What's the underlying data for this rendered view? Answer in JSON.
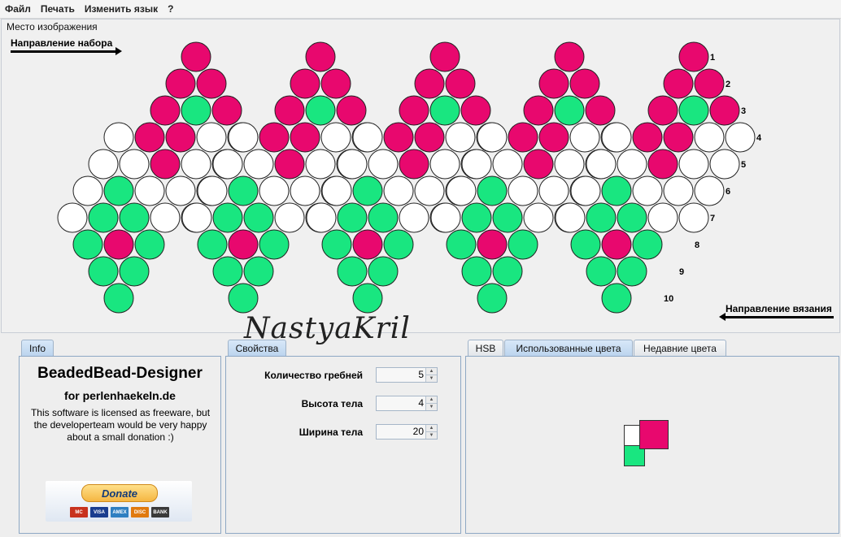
{
  "menu": [
    "Файл",
    "Печать",
    "Изменить язык",
    "?"
  ],
  "canvas": {
    "caption": "Место изображения",
    "direction_set": "Направление набора",
    "direction_knit": "Направление вязания",
    "row_labels": [
      "1",
      "2",
      "3",
      "4",
      "5",
      "6",
      "7",
      "8",
      "9",
      "10"
    ],
    "colors": {
      "pink": "#e8086e",
      "green": "#19e680",
      "white": "#ffffff"
    },
    "pattern": {
      "ribs": 5,
      "rows": [
        "WWWWWWWWWPWWWWWWWWWPWWWWWWWWWPWWWWWWWWWPWWWWWWWWWP",
        "WWWWWWWWPPWWWWWWWWPPWWWWWWWWPPWWWWWWWWPPWWWWWWWWPP",
        "WWWWWWWPGPWWWWWWWPGPWWWWWWWPGPWWWWWWWPGPWWWWWWWPGP",
        "WWWWWWPPWWWWWWWWPPWWWWWWWWPPWWWWWWWWPPWWWWWWWWPPWW"
      ]
    }
  },
  "signature": "NastyaKril",
  "info": {
    "tab": "Info",
    "title": "BeadedBead-Designer",
    "subtitle": "for perlenhaekeln.de",
    "text": "This software is licensed as freeware, but the developerteam would be very happy about a small donation :)",
    "donate_label": "Donate",
    "cards": [
      "MC",
      "VISA",
      "AMEX",
      "DISC",
      "BANK"
    ]
  },
  "properties": {
    "tab": "Свойства",
    "fields": [
      {
        "label": "Количество гребней",
        "value": "5"
      },
      {
        "label": "Высота тела",
        "value": "4"
      },
      {
        "label": "Ширина тела",
        "value": "20"
      }
    ]
  },
  "colors_panel": {
    "tabs": [
      "HSB",
      "Использованные цвета",
      "Недавние цвета"
    ],
    "selected_tab": 1,
    "used_colors": [
      "#e8086e",
      "#ffffff",
      "#19e680"
    ]
  }
}
